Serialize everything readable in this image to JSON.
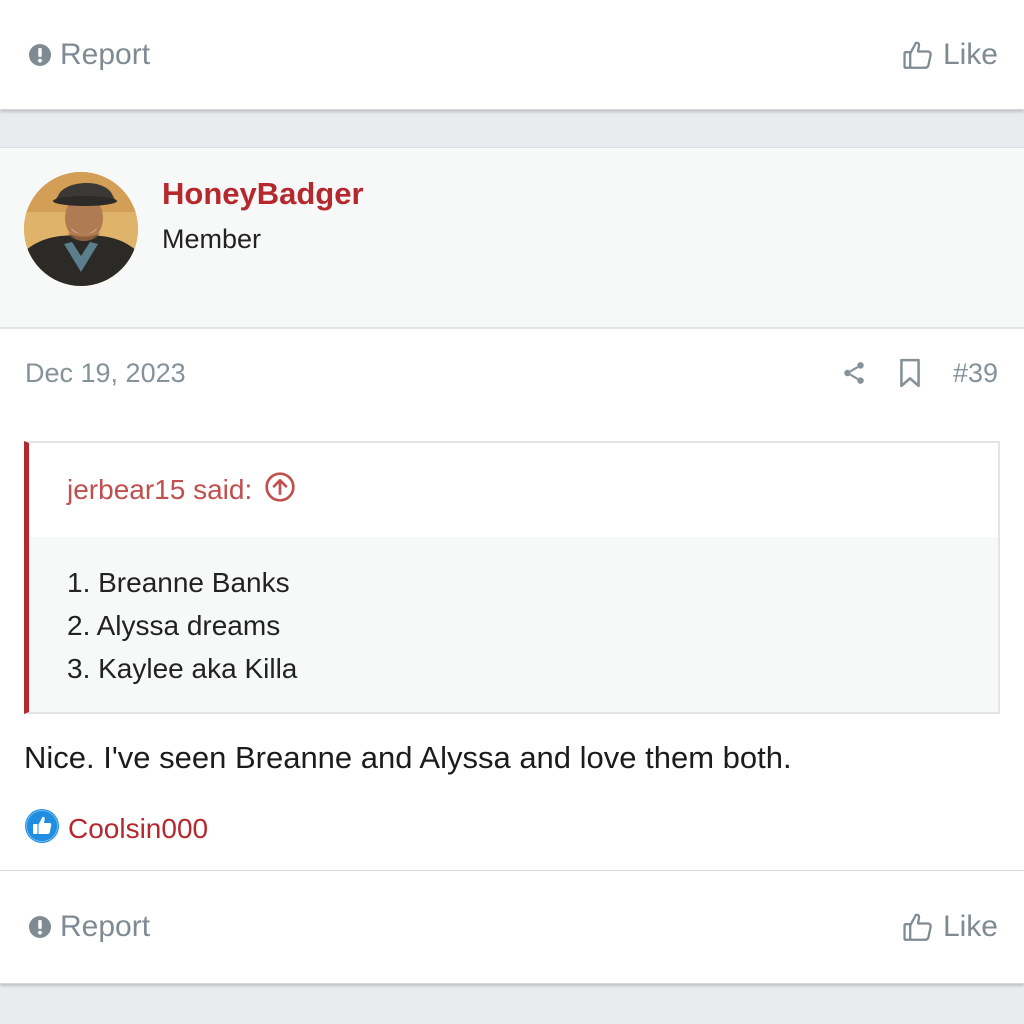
{
  "top_footer": {
    "report_label": "Report",
    "like_label": "Like"
  },
  "post": {
    "author": {
      "name": "HoneyBadger",
      "title": "Member",
      "avatar": "avatar-photo"
    },
    "date": "Dec 19, 2023",
    "number": "#39",
    "quote": {
      "attribution": "jerbear15 said:",
      "lines": [
        "1. Breanne Banks",
        "2. Alyssa dreams",
        "3. Kaylee aka Killa"
      ]
    },
    "message": "Nice. I've seen Breanne and Alyssa and love them both.",
    "reactions": {
      "icon": "thumbs-up-reaction-icon",
      "users": "Coolsin000"
    }
  },
  "bottom_footer": {
    "report_label": "Report",
    "like_label": "Like"
  },
  "colors": {
    "accent": "#b5282d",
    "muted_text": "#7f8b93",
    "like_reaction": "#1f8ee0"
  }
}
